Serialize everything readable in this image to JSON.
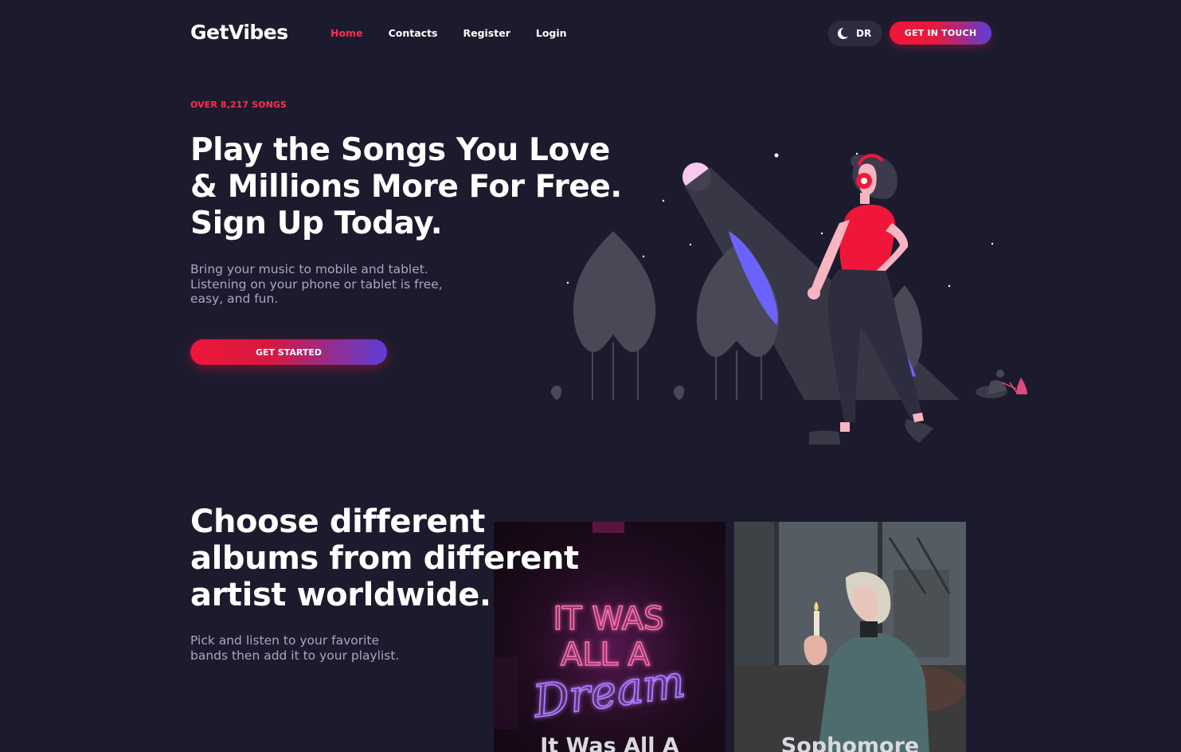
{
  "nav": {
    "logo": "GetVibes",
    "links": [
      "Home",
      "Contacts",
      "Register",
      "Login"
    ],
    "active_link": "Home",
    "theme_toggle_label": "DR",
    "cta_label": "GET IN TOUCH"
  },
  "hero": {
    "eyebrow": "OVER 8,217 SONGS",
    "title_lines": [
      "Play the Songs You Love",
      "& Millions More For Free.",
      "Sign Up Today."
    ],
    "subtitle_lines": [
      "Bring your music to mobile and tablet.",
      "Listening on your phone or tablet is free,",
      "easy, and fun."
    ],
    "button_label": "GET STARTED"
  },
  "albums": {
    "title_lines": [
      "Choose different",
      "albums from different",
      "artist worldwide."
    ],
    "subtitle_lines": [
      "Pick and listen to your favorite",
      "bands then add it to your playlist."
    ],
    "cards": [
      {
        "title": "It Was All A",
        "neon_lines": [
          "IT WAS",
          "ALL A",
          "Dream"
        ]
      },
      {
        "title": "Sophomore"
      }
    ]
  },
  "colors": {
    "background": "#1c1b2e",
    "accent_red": "#ff2d4f",
    "accent_purple": "#5b3fd6",
    "muted_text": "#a8a6c0"
  }
}
